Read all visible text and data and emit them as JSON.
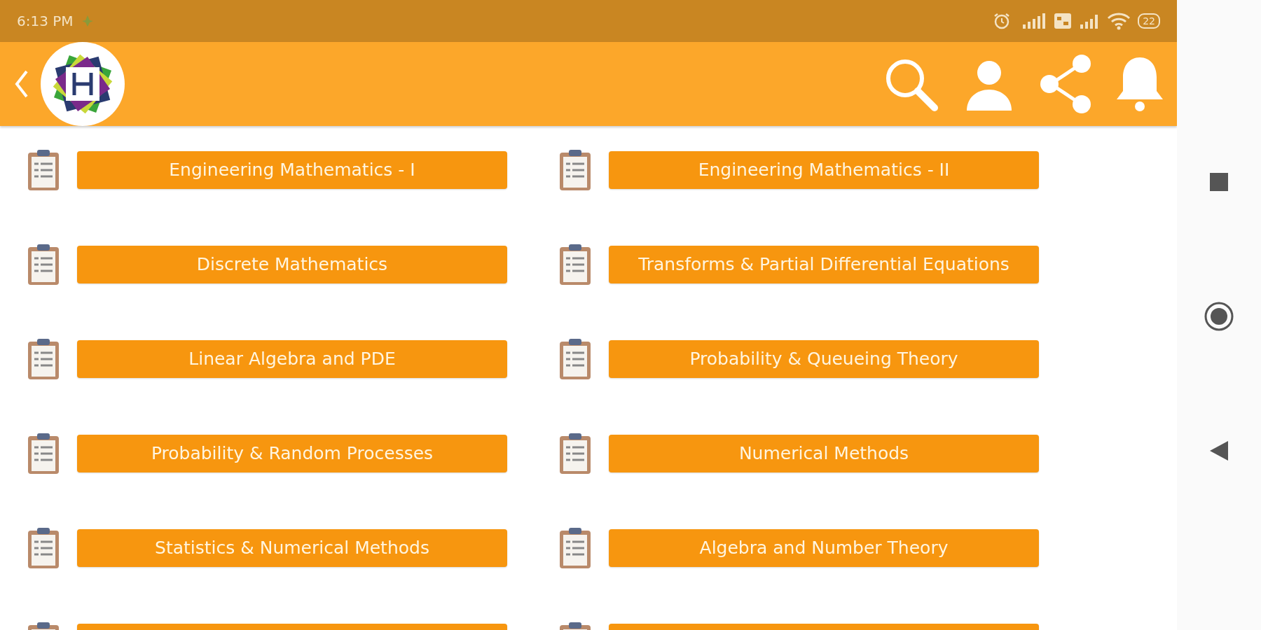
{
  "status_bar": {
    "time": "6:13 PM",
    "battery": "22"
  },
  "subjects": [
    {
      "kind": "topic",
      "label": "Engineering Mathematics - I"
    },
    {
      "kind": "topic",
      "label": "Engineering Mathematics - II"
    },
    {
      "kind": "topic",
      "label": "Discrete Mathematics"
    },
    {
      "kind": "topic",
      "label": "Transforms & Partial Differential Equations"
    },
    {
      "kind": "topic",
      "label": "Linear Algebra and PDE"
    },
    {
      "kind": "topic",
      "label": "Probability & Queueing Theory"
    },
    {
      "kind": "topic",
      "label": "Probability & Random Processes"
    },
    {
      "kind": "topic",
      "label": "Numerical Methods"
    },
    {
      "kind": "topic",
      "label": "Statistics & Numerical Methods"
    },
    {
      "kind": "topic",
      "label": "Algebra and Number Theory"
    },
    {
      "kind": "cut"
    },
    {
      "kind": "cut"
    }
  ]
}
